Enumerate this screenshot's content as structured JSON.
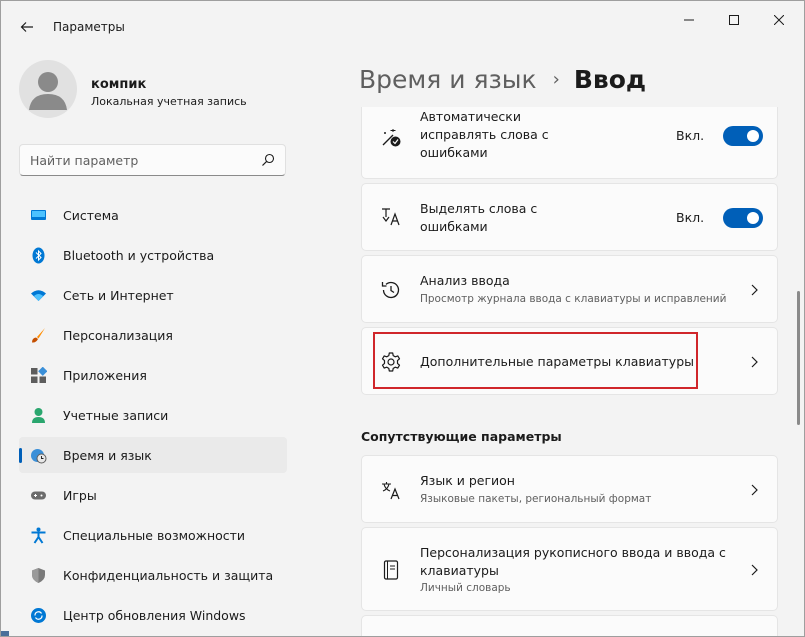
{
  "window": {
    "title": "Параметры",
    "controls": [
      "minimize-icon",
      "maximize-icon",
      "close-icon"
    ]
  },
  "profile": {
    "name": "компик",
    "account_type": "Локальная учетная запись"
  },
  "search": {
    "placeholder": "Найти параметр"
  },
  "sidebar": {
    "items": [
      {
        "label": "Система",
        "icon": "system-icon",
        "active": false
      },
      {
        "label": "Bluetooth и устройства",
        "icon": "bluetooth-icon",
        "active": false
      },
      {
        "label": "Сеть и Интернет",
        "icon": "wifi-icon",
        "active": false
      },
      {
        "label": "Персонализация",
        "icon": "brush-icon",
        "active": false
      },
      {
        "label": "Приложения",
        "icon": "apps-icon",
        "active": false
      },
      {
        "label": "Учетные записи",
        "icon": "account-icon",
        "active": false
      },
      {
        "label": "Время и язык",
        "icon": "time-language-icon",
        "active": true
      },
      {
        "label": "Игры",
        "icon": "gamepad-icon",
        "active": false
      },
      {
        "label": "Специальные возможности",
        "icon": "accessibility-icon",
        "active": false
      },
      {
        "label": "Конфиденциальность и защита",
        "icon": "shield-icon",
        "active": false
      },
      {
        "label": "Центр обновления Windows",
        "icon": "update-icon",
        "active": false
      }
    ]
  },
  "breadcrumb": {
    "parent": "Время и язык",
    "separator": "›",
    "current": "Ввод"
  },
  "settings": {
    "autocorrect": {
      "title_lines": [
        "Автоматически",
        "исправлять слова с",
        "ошибками"
      ],
      "state": "Вкл.",
      "on": true,
      "icon": "autocorrect-icon"
    },
    "highlight": {
      "title_lines": [
        "Выделять слова с",
        "ошибками"
      ],
      "state": "Вкл.",
      "on": true,
      "icon": "highlight-text-icon"
    },
    "typing_insights": {
      "title": "Анализ ввода",
      "subtitle": "Просмотр журнала ввода с клавиатуры и исправлений",
      "icon": "history-icon"
    },
    "advanced_keyboard": {
      "title": "Дополнительные параметры клавиатуры",
      "icon": "gear-icon"
    }
  },
  "related": {
    "heading": "Сопутствующие параметры",
    "language_region": {
      "title": "Язык и регион",
      "subtitle": "Языковые пакеты, региональный формат",
      "icon": "language-icon"
    },
    "pen_input": {
      "title_lines": [
        "Персонализация рукописного ввода и ввода с",
        "клавиатуры"
      ],
      "subtitle": "Личный словарь",
      "icon": "notebook-icon"
    }
  },
  "colors": {
    "accent": "#005fb8",
    "highlight_box": "#d0262b"
  }
}
